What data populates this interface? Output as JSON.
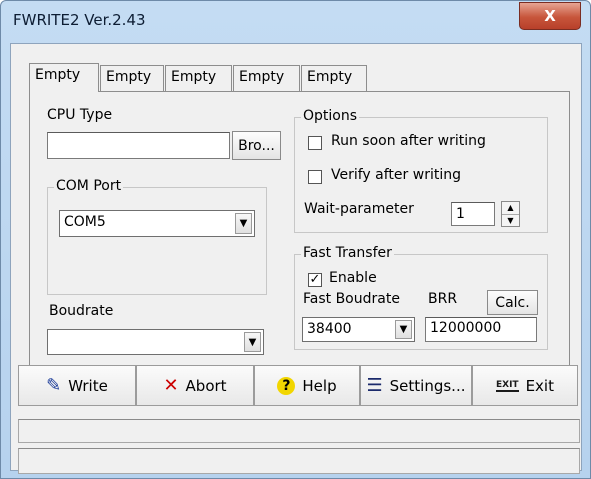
{
  "window": {
    "title": "FWRITE2 Ver.2.43",
    "close_glyph": "X"
  },
  "tabs": [
    "Empty",
    "Empty",
    "Empty",
    "Empty",
    "Empty"
  ],
  "cpu": {
    "label": "CPU Type",
    "value": "",
    "browse_label": "Bro..."
  },
  "com_port": {
    "label": "COM Port",
    "value": "COM5"
  },
  "boudrate": {
    "label": "Boudrate",
    "value": ""
  },
  "options": {
    "label": "Options",
    "run_soon": {
      "label": "Run soon after writing",
      "checked": false
    },
    "verify": {
      "label": "Verify after writing",
      "checked": false
    },
    "wait_label": "Wait-parameter",
    "wait_value": "1"
  },
  "fast_transfer": {
    "label": "Fast Transfer",
    "enable": {
      "label": "Enable",
      "checked": true,
      "check_glyph": "✓"
    },
    "fast_boudrate_label": "Fast Boudrate",
    "fast_boudrate_value": "38400",
    "brr_label": "BRR",
    "brr_value": "12000000",
    "calc_label": "Calc."
  },
  "toolbar": {
    "write": {
      "label": "Write",
      "icon": "pen-icon",
      "glyph": "✎"
    },
    "abort": {
      "label": "Abort",
      "icon": "x-mark-icon",
      "glyph": "✕"
    },
    "help": {
      "label": "Help",
      "icon": "question-bulb-icon",
      "glyph": "?"
    },
    "settings": {
      "label": "Settings...",
      "icon": "settings-form-icon",
      "glyph": "☰"
    },
    "exit": {
      "label": "Exit",
      "icon": "exit-sign-icon",
      "glyph": "EXIT"
    }
  },
  "colors": {
    "title_bar": "#c4dcf3",
    "close_button": "#c7553b",
    "abort_icon": "#cc0000",
    "help_icon": "#e8c800"
  }
}
